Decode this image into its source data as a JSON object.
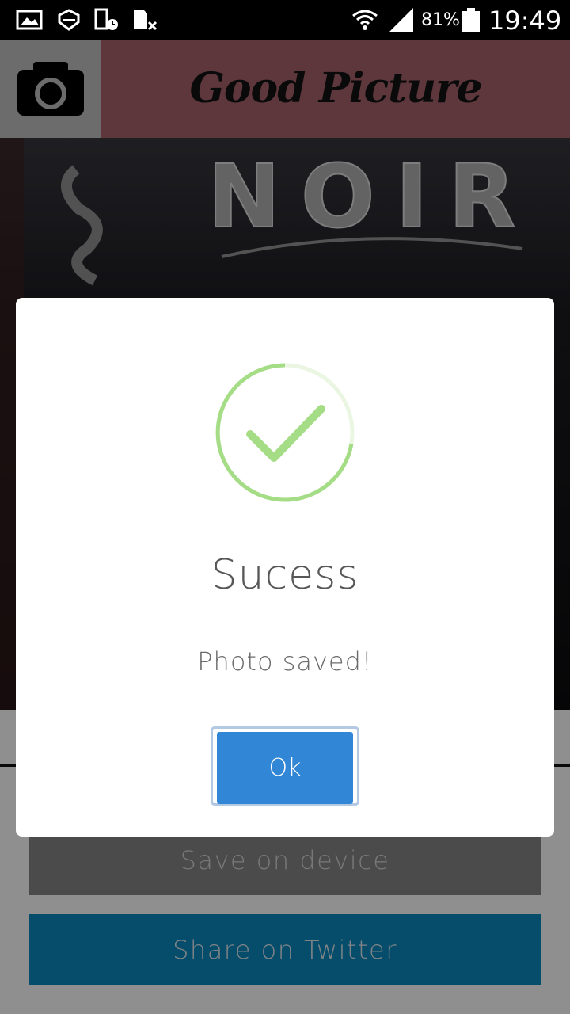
{
  "status_bar": {
    "icons": [
      "gallery-icon",
      "signal-tool-icon",
      "phone-clock-icon",
      "sim-x-icon",
      "wifi-icon",
      "cell-signal-icon",
      "battery-icon"
    ],
    "battery_percent": "81%",
    "time": "19:49"
  },
  "header": {
    "title": "Good Picture",
    "camera_icon": "camera-icon",
    "title_bg_color": "#9c5d64"
  },
  "photo": {
    "visible_text": "NOIR"
  },
  "actions": {
    "save_label": "Save on device",
    "share_label": "Share on Twitter",
    "share_color": "#0a7fb3"
  },
  "dialog": {
    "icon": "success-check-icon",
    "title": "Sucess",
    "message": "Photo saved!",
    "ok_label": "Ok",
    "accent_color": "#3186d6",
    "check_color": "#a5dc86"
  }
}
